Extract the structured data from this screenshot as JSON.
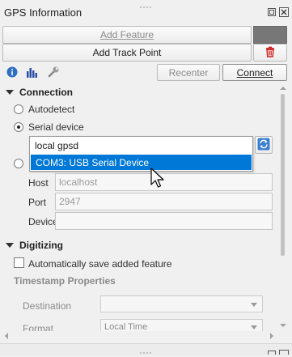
{
  "panel": {
    "title": "GPS Information"
  },
  "toolbar": {
    "add_feature_label": "Add Feature",
    "add_track_point_label": "Add Track Point",
    "recenter_label": "Recenter",
    "connect_label": "Connect",
    "tabs": [
      "info-icon",
      "signal-chart-icon",
      "wrench-icon"
    ]
  },
  "connection": {
    "section_title": "Connection",
    "autodetect_label": "Autodetect",
    "serial_device_label": "Serial device",
    "selected_mode": "Serial device",
    "dropdown_options": [
      "local gpsd",
      "COM3: USB Serial Device"
    ],
    "highlighted_option": "COM3: USB Serial Device",
    "host_label": "Host",
    "host_placeholder": "localhost",
    "port_label": "Port",
    "port_placeholder": "2947",
    "device_label": "Device"
  },
  "digitizing": {
    "section_title": "Digitizing",
    "auto_save_label": "Automatically save added feature",
    "timestamp_section": "Timestamp Properties",
    "destination_label": "Destination",
    "format_label": "Format",
    "format_value": "Local Time"
  },
  "colors": {
    "selection": "#0078d7",
    "delete": "#d11f1f",
    "swatch": "#777777"
  }
}
